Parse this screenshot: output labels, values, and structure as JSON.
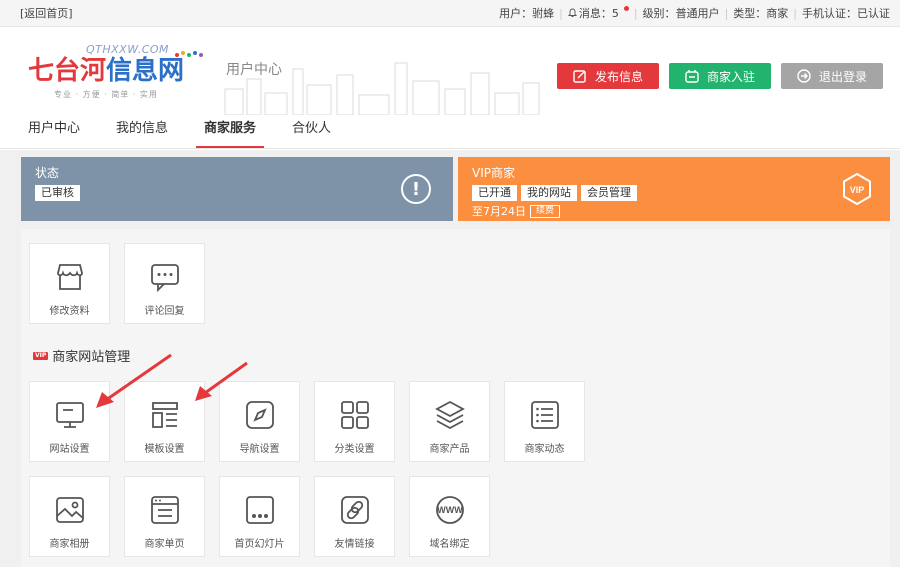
{
  "topbar": {
    "back_home": "[返回首页]",
    "user_label": "用户：",
    "user_name": "驸蜂",
    "messages_label": "消息：",
    "messages_count": "5",
    "level_label": "级别：",
    "level_value": "普通用户",
    "type_label": "类型：",
    "type_value": "商家",
    "phone_label": "手机认证：",
    "phone_value": "已认证"
  },
  "header": {
    "logo_en": "QTHXXW.COM",
    "logo_cn_red": "七台河",
    "logo_cn_blue": "信息网",
    "logo_slogan": "专业 · 方便 · 简单 · 实用",
    "page_title": "用户中心",
    "btn_publish": "发布信息",
    "btn_merchant": "商家入驻",
    "btn_logout": "退出登录"
  },
  "nav": {
    "tabs": [
      {
        "label": "用户中心",
        "active": false
      },
      {
        "label": "我的信息",
        "active": false
      },
      {
        "label": "商家服务",
        "active": true
      },
      {
        "label": "合伙人",
        "active": false
      }
    ]
  },
  "status_card": {
    "title": "状态",
    "tag": "已审核"
  },
  "vip_card": {
    "title": "VIP商家",
    "tags": [
      "已开通",
      "我的网站",
      "会员管理"
    ],
    "expiry": "至7月24日",
    "renew": "续费"
  },
  "tools": [
    {
      "label": "修改资料",
      "icon": "store-icon"
    },
    {
      "label": "评论回复",
      "icon": "comment-icon"
    }
  ],
  "section": {
    "badge": "VIP",
    "title": "商家网站管理"
  },
  "site_tools": [
    {
      "label": "网站设置",
      "icon": "monitor-icon"
    },
    {
      "label": "模板设置",
      "icon": "template-icon"
    },
    {
      "label": "导航设置",
      "icon": "compass-icon"
    },
    {
      "label": "分类设置",
      "icon": "grid-icon"
    },
    {
      "label": "商家产品",
      "icon": "layers-icon"
    },
    {
      "label": "商家动态",
      "icon": "list-icon"
    },
    {
      "label": "商家相册",
      "icon": "album-icon"
    },
    {
      "label": "商家单页",
      "icon": "page-icon"
    },
    {
      "label": "首页幻灯片",
      "icon": "slideshow-icon"
    },
    {
      "label": "友情链接",
      "icon": "link-icon"
    },
    {
      "label": "域名绑定",
      "icon": "www-icon"
    }
  ],
  "colors": {
    "red": "#e4393c",
    "green": "#22b36e",
    "gray": "#a5a5a5",
    "status_card": "#7f93a8",
    "vip_card": "#fb8f3f"
  }
}
